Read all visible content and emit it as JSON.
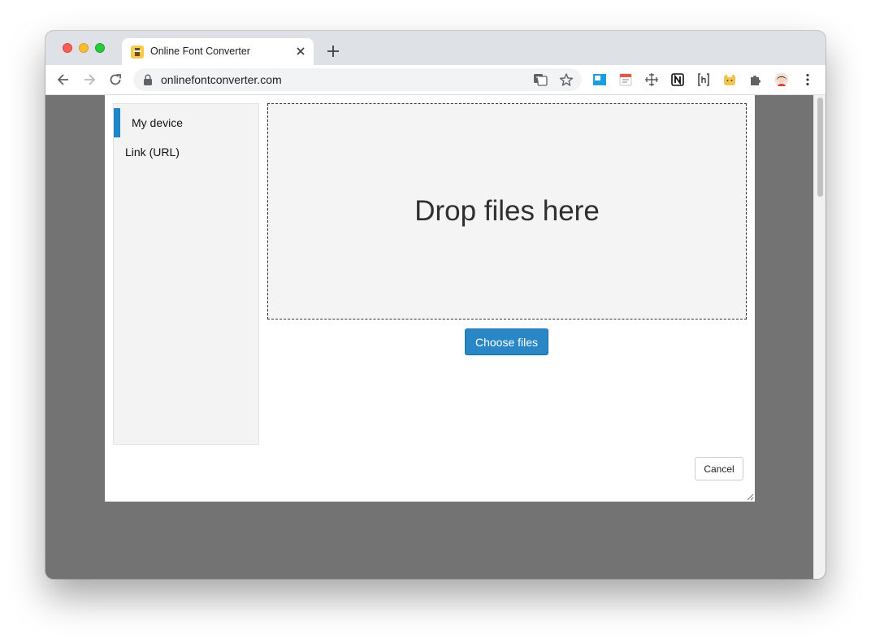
{
  "browser": {
    "tab": {
      "title": "Online Font Converter",
      "favicon": "font-converter-favicon"
    },
    "address_bar": {
      "url": "onlinefontconverter.com"
    },
    "extensions": [
      "translate-icon",
      "bookmark-star-icon",
      "screenshot-extension-icon",
      "calendar-extension-icon",
      "move-extension-icon",
      "notion-icon",
      "hackmd-icon",
      "cat-extension-icon",
      "puzzle-extensions-icon",
      "profile-avatar",
      "kebab-menu-icon"
    ]
  },
  "dialog": {
    "sources": [
      {
        "label": "My device",
        "active": true
      },
      {
        "label": "Link (URL)",
        "active": false
      }
    ],
    "dropzone": {
      "text": "Drop files here"
    },
    "choose_button": "Choose files",
    "cancel_button": "Cancel"
  },
  "colors": {
    "accent": "#2a87c5",
    "active_marker": "#1f86c8",
    "overlay": "#737373"
  }
}
